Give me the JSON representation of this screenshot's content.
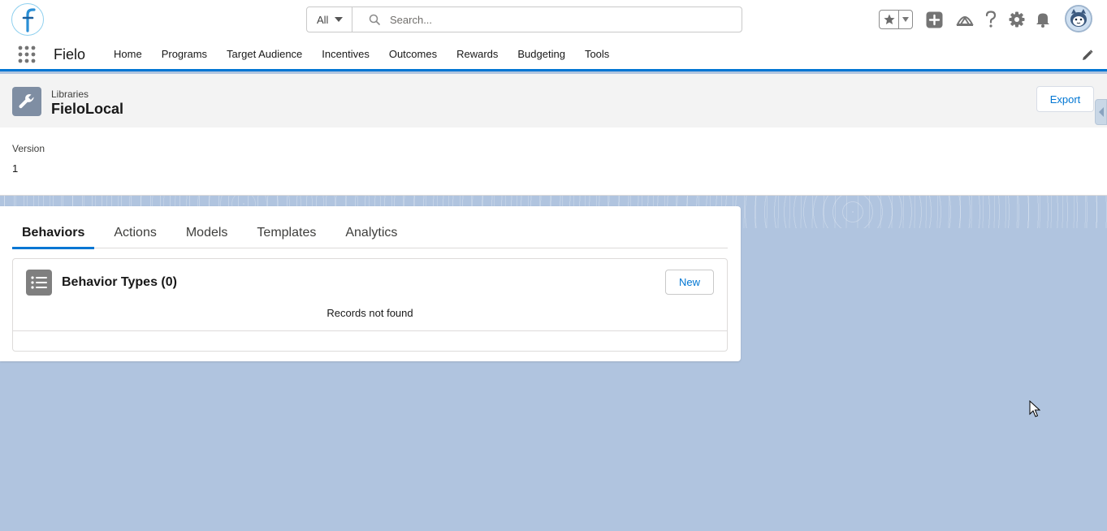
{
  "header": {
    "search": {
      "scope": "All",
      "placeholder": "Search..."
    }
  },
  "nav": {
    "app_name": "Fielo",
    "items": [
      {
        "label": "Home"
      },
      {
        "label": "Programs"
      },
      {
        "label": "Target Audience"
      },
      {
        "label": "Incentives"
      },
      {
        "label": "Outcomes"
      },
      {
        "label": "Rewards"
      },
      {
        "label": "Budgeting"
      },
      {
        "label": "Tools"
      }
    ]
  },
  "record": {
    "object_type": "Libraries",
    "title": "FieloLocal",
    "export_label": "Export"
  },
  "details": {
    "version_label": "Version",
    "version_value": "1"
  },
  "tabs": [
    {
      "label": "Behaviors",
      "active": true
    },
    {
      "label": "Actions"
    },
    {
      "label": "Models"
    },
    {
      "label": "Templates"
    },
    {
      "label": "Analytics"
    }
  ],
  "related": {
    "title": "Behavior Types (0)",
    "new_label": "New",
    "empty_message": "Records not found"
  },
  "colors": {
    "brand_blue": "#0176d3",
    "page_background": "#b0c4df"
  }
}
